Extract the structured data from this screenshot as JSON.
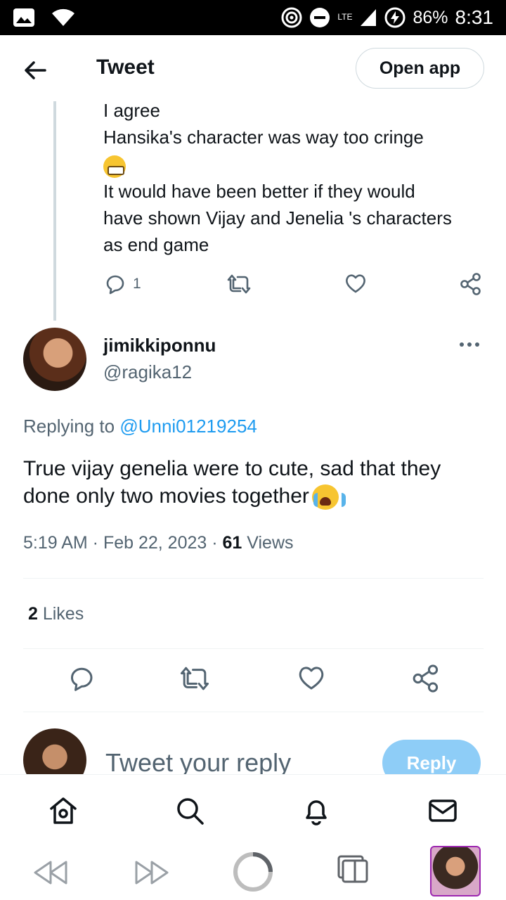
{
  "status_bar": {
    "battery_percent": "86%",
    "time": "8:31",
    "network": "LTE",
    "icons": [
      "gallery-icon",
      "wifi-icon",
      "hotspot-icon",
      "dnd-icon",
      "signal-icon",
      "battery-charging-icon"
    ]
  },
  "header": {
    "title": "Tweet",
    "open_app_label": "Open app",
    "back_icon": "back-arrow-icon"
  },
  "parent_tweet": {
    "lines": [
      "I agree",
      "Hansika's character was way too cringe",
      "It would have been better if they would",
      "have shown Vijay and Jenelia 's characters",
      "as end game"
    ],
    "emoji": "grimacing-face",
    "reply_count": "1"
  },
  "tweet": {
    "display_name": "jimikkiponnu",
    "handle": "@ragika12",
    "replying_prefix": "Replying to",
    "replying_to": "@Unni01219254",
    "body_lines": [
      "True vijay genelia were to cute, sad that they",
      "done only two movies together"
    ],
    "emoji": "loudly-crying-face",
    "timestamp": "5:19 AM · Feb 22, 2023 · ",
    "views_count": "61",
    "views_label": " Views",
    "likes_count": "2",
    "likes_label": " Likes"
  },
  "composer": {
    "placeholder": "Tweet your reply",
    "reply_label": "Reply"
  },
  "bottom_nav": [
    "home-icon",
    "search-icon",
    "notifications-icon",
    "messages-icon"
  ],
  "colors": {
    "accent": "#1d9bf0",
    "reply_button": "#8ecdf7",
    "secondary_text": "#536471",
    "primary_text": "#0f1419",
    "tab_border": "#9c27b0"
  }
}
